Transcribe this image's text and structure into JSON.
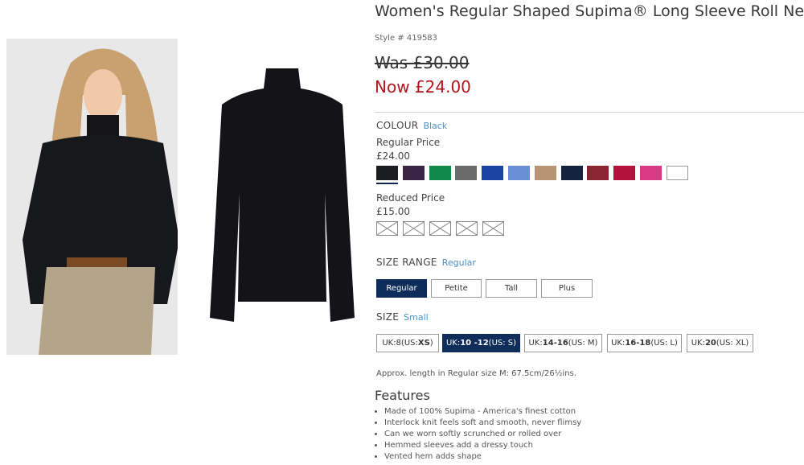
{
  "product": {
    "title": "Women's Regular Shaped Supima® Long Sleeve Roll Neck",
    "style": "Style # 419583",
    "was_price": "Was £30.00",
    "now_price": "Now £24.00"
  },
  "colour": {
    "label": "COLOUR",
    "selected": "Black",
    "regular_price_label": "Regular Price",
    "regular_price": "£24.00",
    "swatches": [
      "#1c1d24",
      "#3b2547",
      "#0f8a4a",
      "#6b6b6b",
      "#1d44a3",
      "#6a8fd6",
      "#b89472",
      "#16233e",
      "#8c2433",
      "#b3123a",
      "#d83a86",
      "#ffffff"
    ],
    "reduced_price_label": "Reduced Price",
    "reduced_price": "£15.00"
  },
  "size_range": {
    "label": "SIZE RANGE",
    "selected": "Regular",
    "options": [
      "Regular",
      "Petite",
      "Tall",
      "Plus"
    ]
  },
  "size": {
    "label": "SIZE",
    "selected": "Small",
    "options": [
      {
        "pre": "UK:8(US: ",
        "bold": "XS",
        "post": ")"
      },
      {
        "pre": "UK:",
        "bold": "10 -12",
        "post": "(US: S)"
      },
      {
        "pre": "UK:",
        "bold": "14-16",
        "post": "(US: M)"
      },
      {
        "pre": "UK:",
        "bold": "16-18",
        "post": "(US: L)"
      },
      {
        "pre": "UK:",
        "bold": "20",
        "post": "(US: XL)"
      }
    ]
  },
  "approx_length": "Approx. length in Regular size M: 67.5cm/26½ins.",
  "features": {
    "heading": "Features",
    "items": [
      "Made of 100% Supima - America's finest cotton",
      "Interlock knit feels soft and smooth, never flimsy",
      "Can we worn softly scrunched or rolled over",
      "Hemmed sleeves add a dressy touch",
      "Vented hem adds shape"
    ]
  }
}
